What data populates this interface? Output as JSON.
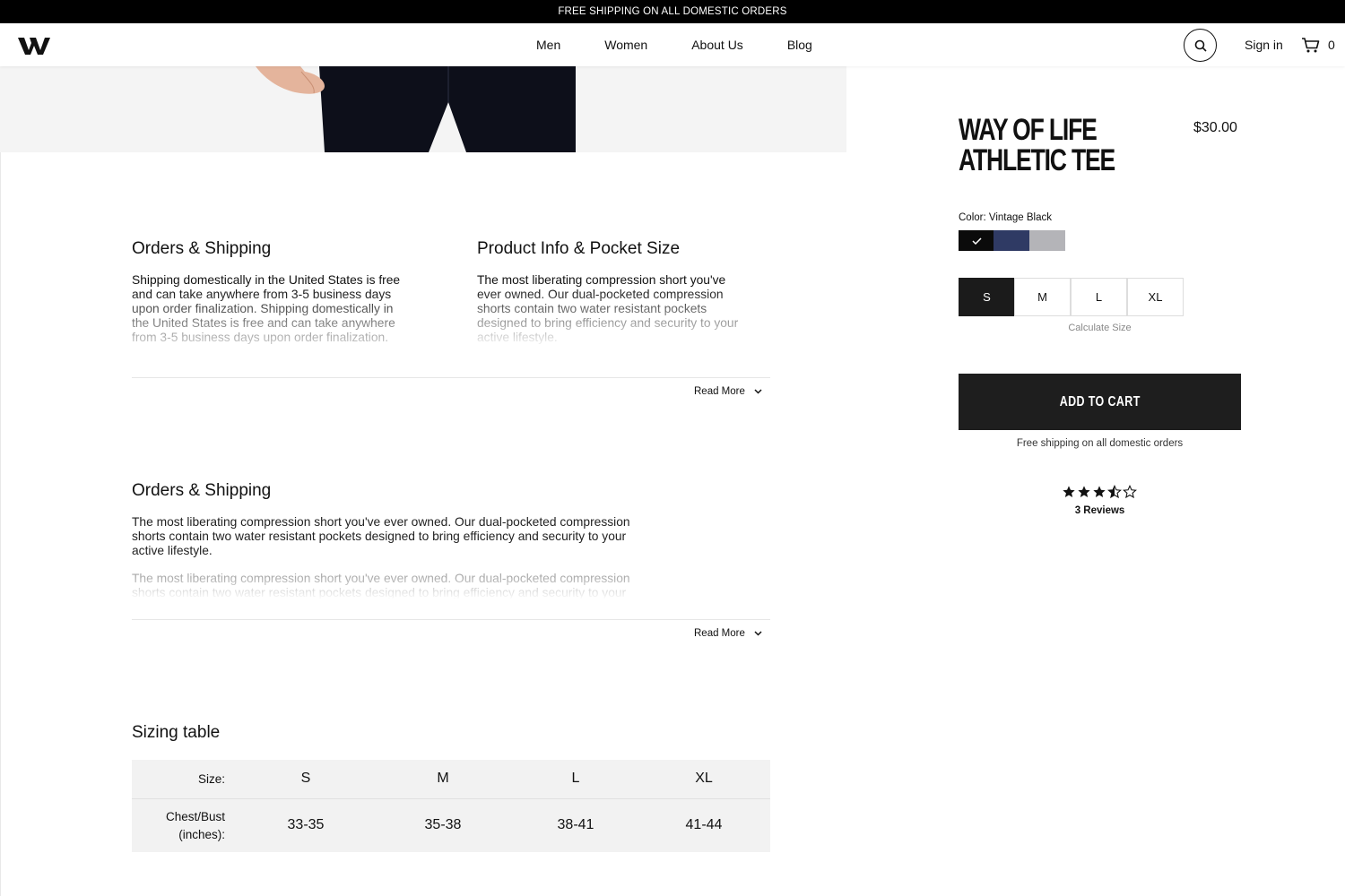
{
  "promo_bar": {
    "text": "FREE SHIPPING ON ALL DOMESTIC ORDERS"
  },
  "header": {
    "logo": "wol-logo",
    "nav": [
      "Men",
      "Women",
      "About Us",
      "Blog"
    ],
    "search_icon": "search-icon",
    "sign_in": "Sign in",
    "cart_icon": "cart-icon",
    "cart_count": "0"
  },
  "sections": {
    "orders_shipping_1": {
      "title": "Orders & Shipping",
      "body": "Shipping domestically in the United States is free and can take anywhere from 3-5 business days upon order finalization. Shipping domestically in the United States is free and can take anywhere from 3-5 business days upon order finalization."
    },
    "product_info": {
      "title": "Product Info & Pocket Size",
      "body": "The most liberating compression short you've ever owned. Our dual-pocketed compression shorts contain two water resistant pockets designed to bring efficiency and security to your active lifestyle."
    },
    "read_more_1": "Read More",
    "orders_shipping_2": {
      "title": "Orders & Shipping",
      "body_1": "The most liberating compression short you've ever owned. Our dual-pocketed compression shorts contain two water resistant pockets designed to bring efficiency and security to your active lifestyle.",
      "body_2": "The most liberating compression short you've ever owned. Our dual-pocketed compression shorts contain two water resistant pockets designed to bring efficiency and security to your active lifestyle."
    },
    "read_more_2": "Read More"
  },
  "sizing_table": {
    "title": "Sizing table",
    "size_label": "Size:",
    "sizes": [
      "S",
      "M",
      "L",
      "XL"
    ],
    "chest_label_line1": "Chest/Bust",
    "chest_label_line2": "(inches):",
    "chest_values": [
      "33-35",
      "35-38",
      "38-41",
      "41-44"
    ]
  },
  "product": {
    "title": "Way of Life Athletic Tee",
    "price": "$30.00",
    "color_label": "Color: Vintage Black",
    "colors": [
      {
        "name": "Vintage Black",
        "hex": "#0b0b0b",
        "selected": true
      },
      {
        "name": "Navy",
        "hex": "#2f3a64",
        "selected": false
      },
      {
        "name": "Grey",
        "hex": "#b4b4b8",
        "selected": false
      }
    ],
    "sizes": [
      "S",
      "M",
      "L",
      "XL"
    ],
    "selected_size": "S",
    "calculate_size": "Calculate Size",
    "add_to_cart": "ADD TO CART",
    "free_shipping": "Free shipping on all domestic orders",
    "rating": 3.5,
    "rating_max": 5,
    "reviews": "3 Reviews"
  },
  "colors": {
    "accent": "#1e1e1e",
    "promo_bg": "#000000",
    "table_bg": "#f2f2f2"
  }
}
